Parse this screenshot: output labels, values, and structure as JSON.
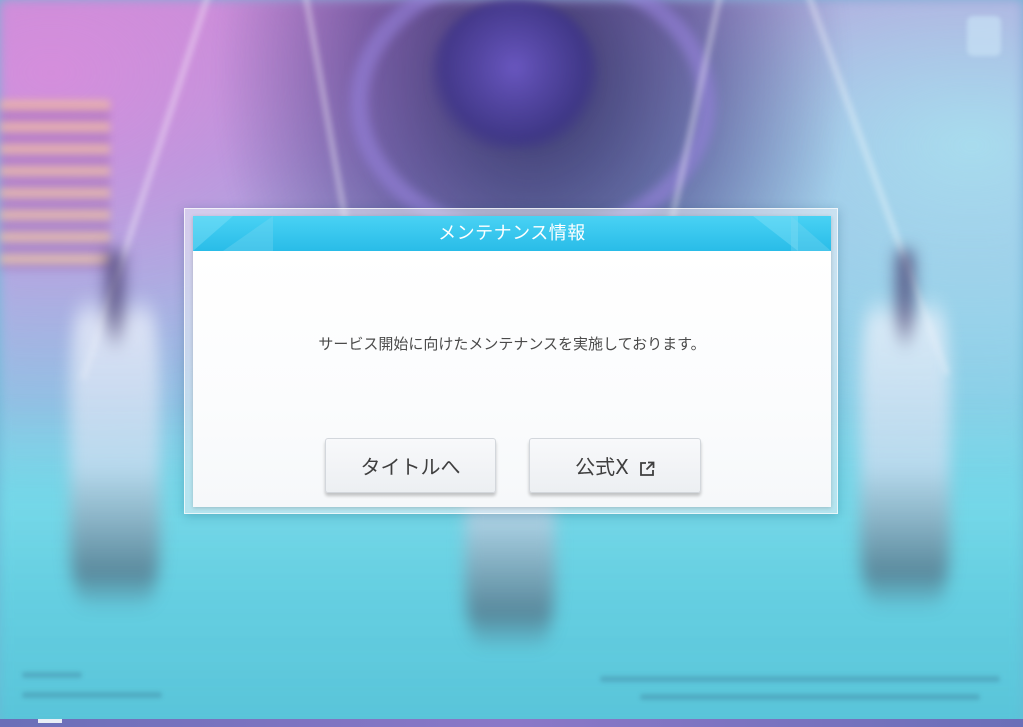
{
  "dialog": {
    "title": "メンテナンス情報",
    "message": "サービス開始に向けたメンテナンスを実施しております。",
    "buttons": {
      "to_title": "タイトルへ",
      "official_x": "公式X"
    },
    "icons": {
      "external_link": "external-link-icon"
    },
    "colors": {
      "header": "#29bce8",
      "header_light": "#49d2f4",
      "text": "#4a4a4a",
      "button_text": "#3f3f3f"
    }
  }
}
